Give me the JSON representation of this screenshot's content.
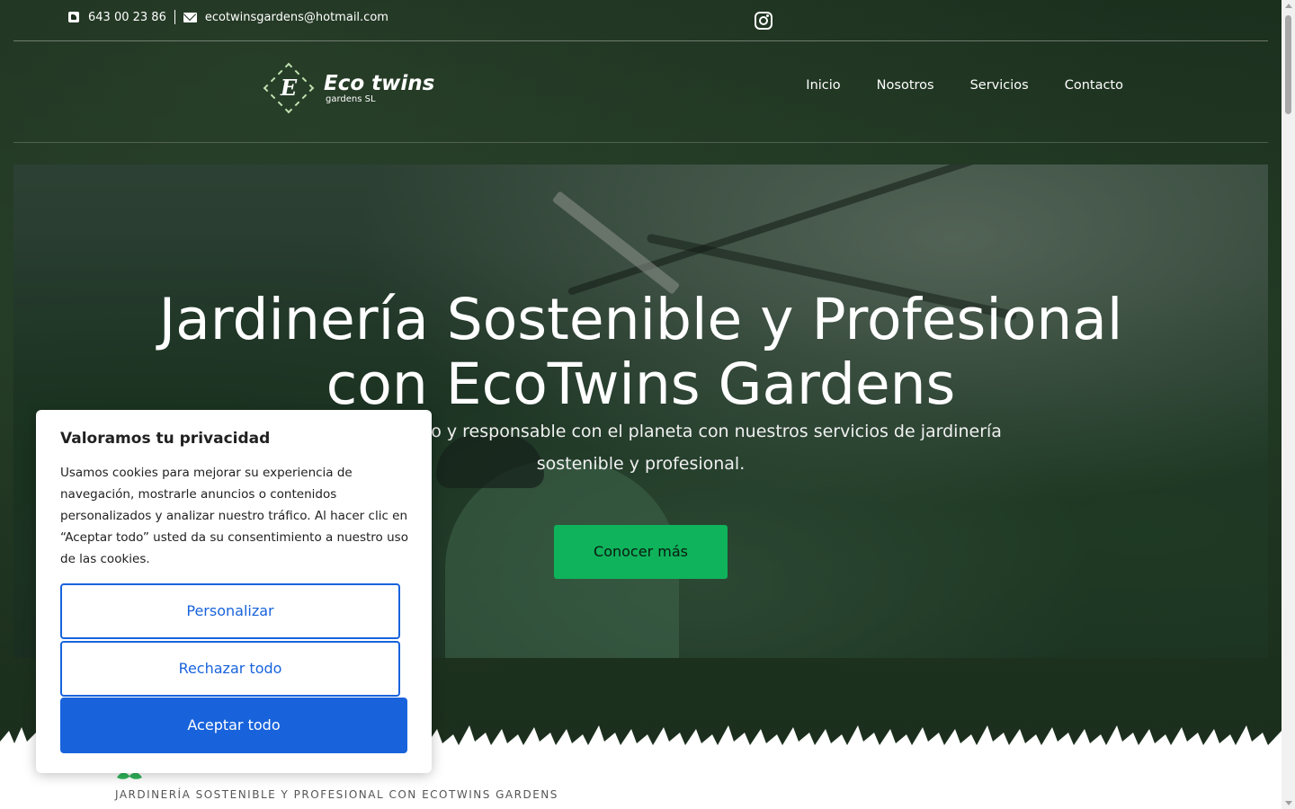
{
  "topbar": {
    "phone": "643 00 23 86",
    "email": "ecotwinsgardens@hotmail.com"
  },
  "logo": {
    "letter": "E",
    "name": "Eco twins",
    "sub": "gardens SL"
  },
  "nav": {
    "items": [
      "Inicio",
      "Nosotros",
      "Servicios",
      "Contacto"
    ]
  },
  "hero": {
    "title_line1": "Jardinería Sostenible y Profesional",
    "title_line2": "con EcoTwins Gardens",
    "subtitle_line1": "en un jardín bonito y responsable con el planeta con nuestros servicios de jardinería",
    "subtitle_line2": "sostenible y profesional.",
    "cta": "Conocer más"
  },
  "section": {
    "label": "JARDINERÍA SOSTENIBLE Y PROFESIONAL CON ECOTWINS GARDENS"
  },
  "cookie": {
    "title": "Valoramos tu privacidad",
    "text": "Usamos cookies para mejorar su experiencia de navegación, mostrarle anuncios o contenidos personalizados y analizar nuestro tráfico. Al hacer clic en “Aceptar todo” usted da su consentimiento a nuestro uso de las cookies.",
    "customize": "Personalizar",
    "reject": "Rechazar todo",
    "accept": "Aceptar todo"
  },
  "colors": {
    "header_bg": "#1c2f1e",
    "cta_green": "#0fb35b",
    "cookie_blue": "#1863dc"
  }
}
